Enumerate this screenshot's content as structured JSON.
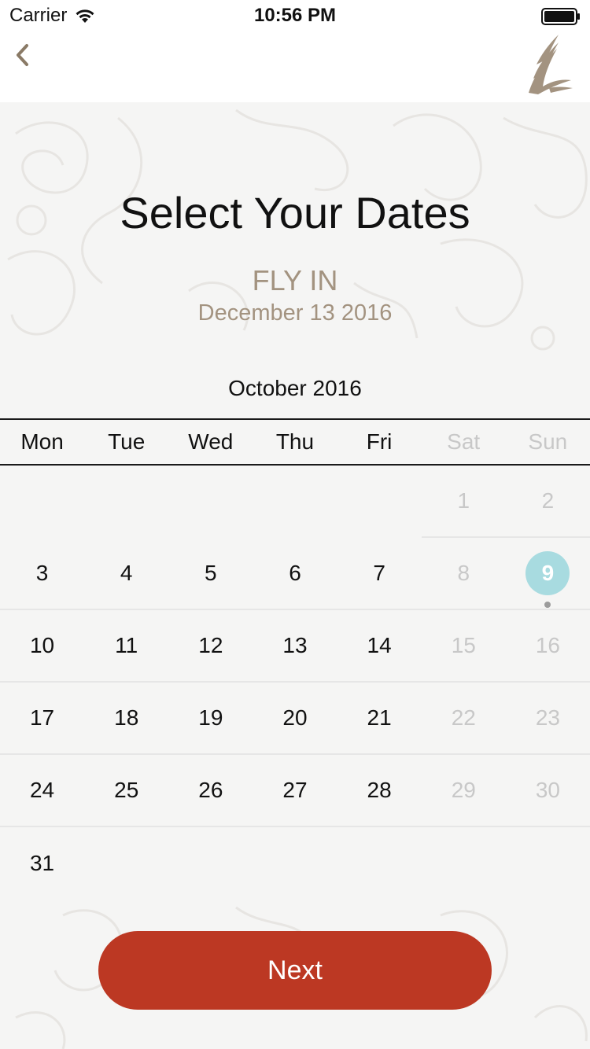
{
  "status_bar": {
    "carrier": "Carrier",
    "time": "10:56 PM"
  },
  "nav": {
    "back_icon": "chevron-left-icon",
    "logo_icon": "airline-bird-logo-icon"
  },
  "hero": {
    "title": "Select Your Dates",
    "fly_label": "FLY IN",
    "fly_date": "December 13 2016"
  },
  "calendar": {
    "month_title": "October 2016",
    "weekdays": [
      "Mon",
      "Tue",
      "Wed",
      "Thu",
      "Fri",
      "Sat",
      "Sun"
    ],
    "days": [
      "1",
      "2",
      "3",
      "4",
      "5",
      "6",
      "7",
      "8",
      "9",
      "10",
      "11",
      "12",
      "13",
      "14",
      "15",
      "16",
      "17",
      "18",
      "19",
      "20",
      "21",
      "22",
      "23",
      "24",
      "25",
      "26",
      "27",
      "28",
      "29",
      "30",
      "31"
    ],
    "today": "9"
  },
  "actions": {
    "next_label": "Next"
  },
  "colors": {
    "accent": "#a39380",
    "button": "#bc3823",
    "today_highlight": "#a8dbe0",
    "weekend_text": "#c8c8c8"
  }
}
